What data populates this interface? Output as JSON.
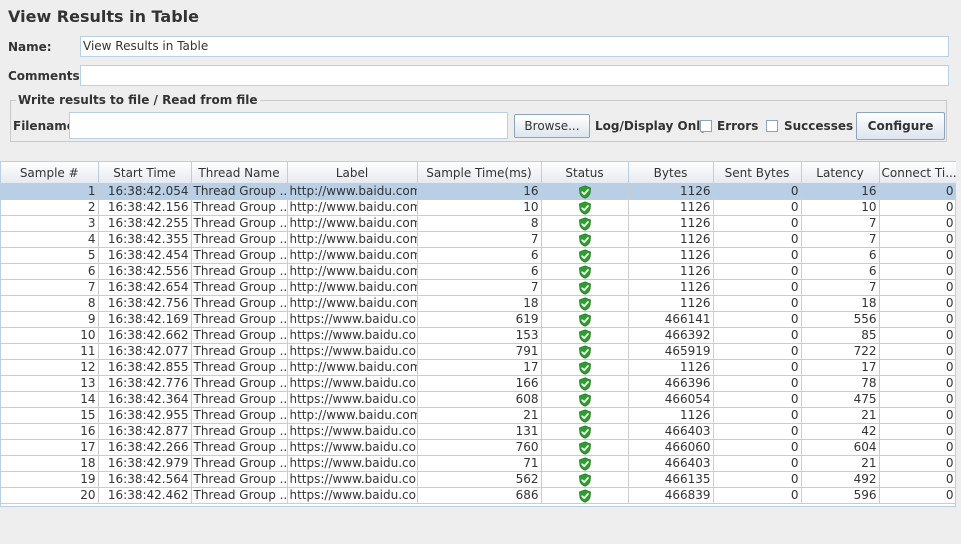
{
  "title": "View Results in Table",
  "name": {
    "label": "Name:",
    "value": "View Results in Table"
  },
  "comments": {
    "label": "Comments:",
    "value": ""
  },
  "file_panel": {
    "title": "Write results to file / Read from file",
    "filename_label": "Filename",
    "filename_value": "",
    "browse_label": "Browse...",
    "log_display_label": "Log/Display Only:",
    "errors_label": "Errors",
    "successes_label": "Successes",
    "configure_label": "Configure",
    "errors_checked": false,
    "successes_checked": false
  },
  "table": {
    "headers": [
      "Sample #",
      "Start Time",
      "Thread Name",
      "Label",
      "Sample Time(ms)",
      "Status",
      "Bytes",
      "Sent Bytes",
      "Latency",
      "Connect Ti..."
    ],
    "selected_row": 0,
    "status_icon": "success-shield-icon",
    "status_color": "#2e9e2e",
    "rows": [
      {
        "sample": "1",
        "start": "16:38:42.054",
        "thread": "Thread Group ...",
        "label": "http://www.baidu.com/",
        "time": "16",
        "bytes": "1126",
        "sent": "0",
        "latency": "16",
        "connect": "0"
      },
      {
        "sample": "2",
        "start": "16:38:42.156",
        "thread": "Thread Group ...",
        "label": "http://www.baidu.com/",
        "time": "10",
        "bytes": "1126",
        "sent": "0",
        "latency": "10",
        "connect": "0"
      },
      {
        "sample": "3",
        "start": "16:38:42.255",
        "thread": "Thread Group ...",
        "label": "http://www.baidu.com/",
        "time": "8",
        "bytes": "1126",
        "sent": "0",
        "latency": "7",
        "connect": "0"
      },
      {
        "sample": "4",
        "start": "16:38:42.355",
        "thread": "Thread Group ...",
        "label": "http://www.baidu.com/",
        "time": "7",
        "bytes": "1126",
        "sent": "0",
        "latency": "7",
        "connect": "0"
      },
      {
        "sample": "5",
        "start": "16:38:42.454",
        "thread": "Thread Group ...",
        "label": "http://www.baidu.com/",
        "time": "6",
        "bytes": "1126",
        "sent": "0",
        "latency": "6",
        "connect": "0"
      },
      {
        "sample": "6",
        "start": "16:38:42.556",
        "thread": "Thread Group ...",
        "label": "http://www.baidu.com/",
        "time": "6",
        "bytes": "1126",
        "sent": "0",
        "latency": "6",
        "connect": "0"
      },
      {
        "sample": "7",
        "start": "16:38:42.654",
        "thread": "Thread Group ...",
        "label": "http://www.baidu.com/",
        "time": "7",
        "bytes": "1126",
        "sent": "0",
        "latency": "7",
        "connect": "0"
      },
      {
        "sample": "8",
        "start": "16:38:42.756",
        "thread": "Thread Group ...",
        "label": "http://www.baidu.com/",
        "time": "18",
        "bytes": "1126",
        "sent": "0",
        "latency": "18",
        "connect": "0"
      },
      {
        "sample": "9",
        "start": "16:38:42.169",
        "thread": "Thread Group ...",
        "label": "https://www.baidu.co...",
        "time": "619",
        "bytes": "466141",
        "sent": "0",
        "latency": "556",
        "connect": "0"
      },
      {
        "sample": "10",
        "start": "16:38:42.662",
        "thread": "Thread Group ...",
        "label": "https://www.baidu.co...",
        "time": "153",
        "bytes": "466392",
        "sent": "0",
        "latency": "85",
        "connect": "0"
      },
      {
        "sample": "11",
        "start": "16:38:42.077",
        "thread": "Thread Group ...",
        "label": "https://www.baidu.co...",
        "time": "791",
        "bytes": "465919",
        "sent": "0",
        "latency": "722",
        "connect": "0"
      },
      {
        "sample": "12",
        "start": "16:38:42.855",
        "thread": "Thread Group ...",
        "label": "http://www.baidu.com/",
        "time": "17",
        "bytes": "1126",
        "sent": "0",
        "latency": "17",
        "connect": "0"
      },
      {
        "sample": "13",
        "start": "16:38:42.776",
        "thread": "Thread Group ...",
        "label": "https://www.baidu.co...",
        "time": "166",
        "bytes": "466396",
        "sent": "0",
        "latency": "78",
        "connect": "0"
      },
      {
        "sample": "14",
        "start": "16:38:42.364",
        "thread": "Thread Group ...",
        "label": "https://www.baidu.co...",
        "time": "608",
        "bytes": "466054",
        "sent": "0",
        "latency": "475",
        "connect": "0"
      },
      {
        "sample": "15",
        "start": "16:38:42.955",
        "thread": "Thread Group ...",
        "label": "http://www.baidu.com/",
        "time": "21",
        "bytes": "1126",
        "sent": "0",
        "latency": "21",
        "connect": "0"
      },
      {
        "sample": "16",
        "start": "16:38:42.877",
        "thread": "Thread Group ...",
        "label": "https://www.baidu.co...",
        "time": "131",
        "bytes": "466403",
        "sent": "0",
        "latency": "42",
        "connect": "0"
      },
      {
        "sample": "17",
        "start": "16:38:42.266",
        "thread": "Thread Group ...",
        "label": "https://www.baidu.co...",
        "time": "760",
        "bytes": "466060",
        "sent": "0",
        "latency": "604",
        "connect": "0"
      },
      {
        "sample": "18",
        "start": "16:38:42.979",
        "thread": "Thread Group ...",
        "label": "https://www.baidu.co...",
        "time": "71",
        "bytes": "466403",
        "sent": "0",
        "latency": "21",
        "connect": "0"
      },
      {
        "sample": "19",
        "start": "16:38:42.564",
        "thread": "Thread Group ...",
        "label": "https://www.baidu.co...",
        "time": "562",
        "bytes": "466135",
        "sent": "0",
        "latency": "492",
        "connect": "0"
      },
      {
        "sample": "20",
        "start": "16:38:42.462",
        "thread": "Thread Group ...",
        "label": "https://www.baidu.co...",
        "time": "686",
        "bytes": "466839",
        "sent": "0",
        "latency": "596",
        "connect": "0"
      }
    ]
  }
}
